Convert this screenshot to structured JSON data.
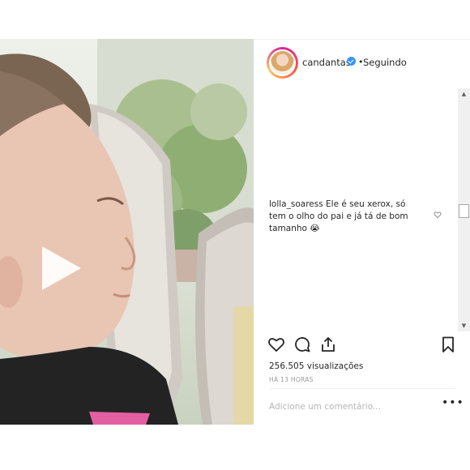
{
  "header": {
    "username": "candantas",
    "separator": "•",
    "follow_status": "Seguindo"
  },
  "comment": {
    "username": "lolla_soaress",
    "text": "Ele é seu xerox, só tem o olho do pai e já tá de bom tamanho 😭"
  },
  "stats": {
    "views": "256.505 visualizações",
    "time": "HÁ 13 HORAS"
  },
  "composer": {
    "placeholder": "Adicione um comentário...",
    "more_label": "•••"
  },
  "scrollbar": {
    "up": "▲",
    "down": "▼"
  },
  "colors": {
    "verified": "#3897f0",
    "text": "#262626",
    "muted": "#999999"
  },
  "icons": {
    "video_control": "play-icon",
    "verified": "verified-badge-icon",
    "like": "heart-icon",
    "comment": "comment-icon",
    "share": "share-icon",
    "save": "bookmark-icon",
    "comment_like": "small-heart-icon",
    "more": "more-options-icon"
  }
}
